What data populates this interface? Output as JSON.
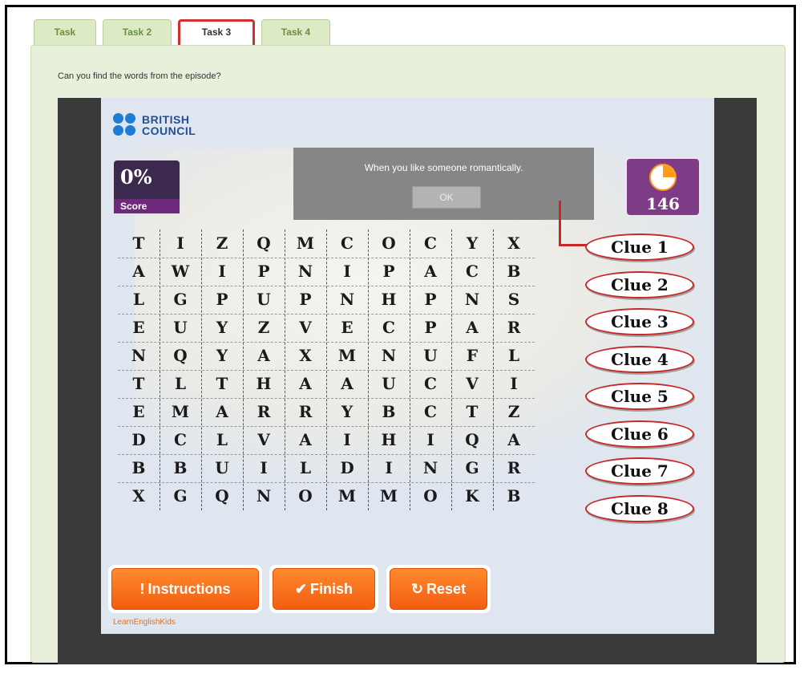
{
  "tabs": [
    {
      "label": "Task"
    },
    {
      "label": "Task 2"
    },
    {
      "label": "Task 3"
    },
    {
      "label": "Task 4"
    }
  ],
  "prompt": "Can you find the words from the episode?",
  "logo": {
    "line1": "BRITISH",
    "line2": "COUNCIL"
  },
  "score": {
    "value": "0%",
    "label": "Score"
  },
  "timer": {
    "value": "146"
  },
  "clue_popup": {
    "text": "When you like someone romantically.",
    "ok_label": "OK"
  },
  "grid": [
    [
      "T",
      "I",
      "Z",
      "Q",
      "M",
      "C",
      "O",
      "C",
      "Y",
      "X"
    ],
    [
      "A",
      "W",
      "I",
      "P",
      "N",
      "I",
      "P",
      "A",
      "C",
      "B"
    ],
    [
      "L",
      "G",
      "P",
      "U",
      "P",
      "N",
      "H",
      "P",
      "N",
      "S"
    ],
    [
      "E",
      "U",
      "Y",
      "Z",
      "V",
      "E",
      "C",
      "P",
      "A",
      "R"
    ],
    [
      "N",
      "Q",
      "Y",
      "A",
      "X",
      "M",
      "N",
      "U",
      "F",
      "L"
    ],
    [
      "T",
      "L",
      "T",
      "H",
      "A",
      "A",
      "U",
      "C",
      "V",
      "I"
    ],
    [
      "E",
      "M",
      "A",
      "R",
      "R",
      "Y",
      "B",
      "C",
      "T",
      "Z"
    ],
    [
      "D",
      "C",
      "L",
      "V",
      "A",
      "I",
      "H",
      "I",
      "Q",
      "A"
    ],
    [
      "B",
      "B",
      "U",
      "I",
      "L",
      "D",
      "I",
      "N",
      "G",
      "R"
    ],
    [
      "X",
      "G",
      "Q",
      "N",
      "O",
      "M",
      "M",
      "O",
      "K",
      "B"
    ]
  ],
  "clues": [
    {
      "label": "Clue 1"
    },
    {
      "label": "Clue 2"
    },
    {
      "label": "Clue 3"
    },
    {
      "label": "Clue 4"
    },
    {
      "label": "Clue 5"
    },
    {
      "label": "Clue 6"
    },
    {
      "label": "Clue 7"
    },
    {
      "label": "Clue 8"
    }
  ],
  "buttons": {
    "instructions": {
      "label": "Instructions",
      "icon": "exclamation-icon"
    },
    "finish": {
      "label": "Finish",
      "icon": "check-icon"
    },
    "reset": {
      "label": "Reset",
      "icon": "reset-icon"
    }
  },
  "footer": {
    "site_name": "LearnEnglishKids"
  },
  "colors": {
    "accent_orange": "#f25d10",
    "highlight_red": "#c62828",
    "tab_green": "#dcebc6",
    "score_purple": "#6e2a7a"
  }
}
